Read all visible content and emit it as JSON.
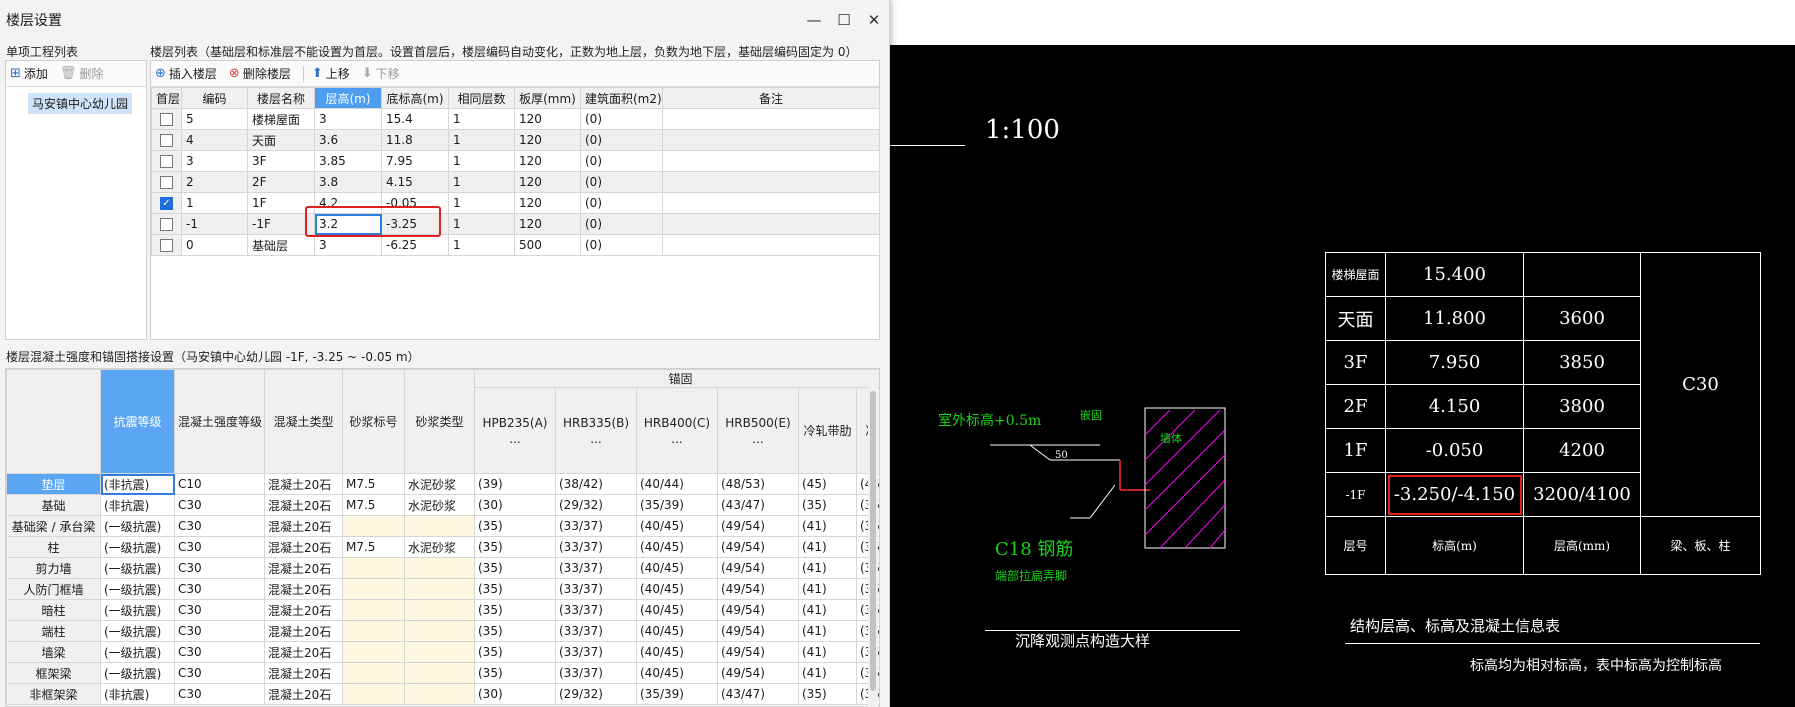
{
  "dialog": {
    "title": "楼层设置",
    "project_section_label": "单项工程列表",
    "floor_list_label": "楼层列表（基础层和标准层不能设置为首层。设置首层后，楼层编码自动变化，正数为地上层，负数为地下层，基础层编码固定为 0）",
    "project_toolbar": {
      "add": "添加",
      "delete": "删除"
    },
    "project_item": "马安镇中心幼儿园",
    "floor_toolbar": {
      "insert": "插入楼层",
      "delete": "删除楼层",
      "up": "上移",
      "down": "下移"
    },
    "floor_columns": [
      "首层",
      "编码",
      "楼层名称",
      "层高(m)",
      "底标高(m)",
      "相同层数",
      "板厚(mm)",
      "建筑面积(m2)",
      "备注"
    ],
    "floors": [
      {
        "code": "5",
        "name": "楼梯屋面",
        "height": "3",
        "bottom": "15.4",
        "same": "1",
        "slab": "120",
        "area": "(0)",
        "note": "",
        "first": false
      },
      {
        "code": "4",
        "name": "天面",
        "height": "3.6",
        "bottom": "11.8",
        "same": "1",
        "slab": "120",
        "area": "(0)",
        "note": "",
        "first": false
      },
      {
        "code": "3",
        "name": "3F",
        "height": "3.85",
        "bottom": "7.95",
        "same": "1",
        "slab": "120",
        "area": "(0)",
        "note": "",
        "first": false
      },
      {
        "code": "2",
        "name": "2F",
        "height": "3.8",
        "bottom": "4.15",
        "same": "1",
        "slab": "120",
        "area": "(0)",
        "note": "",
        "first": false
      },
      {
        "code": "1",
        "name": "1F",
        "height": "4.2",
        "bottom": "-0.05",
        "same": "1",
        "slab": "120",
        "area": "(0)",
        "note": "",
        "first": true
      },
      {
        "code": "-1",
        "name": "-1F",
        "height": "3.2",
        "bottom": "-3.25",
        "same": "1",
        "slab": "120",
        "area": "(0)",
        "note": "",
        "first": false
      },
      {
        "code": "0",
        "name": "基础层",
        "height": "3",
        "bottom": "-6.25",
        "same": "1",
        "slab": "500",
        "area": "(0)",
        "note": "",
        "first": false
      }
    ],
    "concrete_label": "楼层混凝土强度和锚固搭接设置（马安镇中心幼儿园  -1F, -3.25 ~ -0.05 m）",
    "conc_columns": [
      "抗震等级",
      "混凝土强度等级",
      "混凝土类型",
      "砂浆标号",
      "砂浆类型",
      "HPB235(A)",
      "HRB335(B)",
      "HRB400(C)",
      "HRB500(E)",
      "冷轧带肋",
      "冷"
    ],
    "anchor_group": "锚固",
    "ellipsis": "...",
    "conc_rows": [
      {
        "name": "垫层",
        "level": "(非抗震)",
        "grade": "C10",
        "type": "混凝土20石",
        "mortar": "M7.5",
        "mtype": "水泥砂浆",
        "a": "(39)",
        "b": "(38/42)",
        "c": "(40/44)",
        "e": "(48/53)",
        "f": "(45)",
        "g": "(45"
      },
      {
        "name": "基础",
        "level": "(非抗震)",
        "grade": "C30",
        "type": "混凝土20石",
        "mortar": "M7.5",
        "mtype": "水泥砂浆",
        "a": "(30)",
        "b": "(29/32)",
        "c": "(35/39)",
        "e": "(43/47)",
        "f": "(35)",
        "g": "(35"
      },
      {
        "name": "基础梁 / 承台梁",
        "level": "(一级抗震)",
        "grade": "C30",
        "type": "混凝土20石",
        "mortar": "",
        "mtype": "",
        "a": "(35)",
        "b": "(33/37)",
        "c": "(40/45)",
        "e": "(49/54)",
        "f": "(41)",
        "g": "(35"
      },
      {
        "name": "柱",
        "level": "(一级抗震)",
        "grade": "C30",
        "type": "混凝土20石",
        "mortar": "M7.5",
        "mtype": "水泥砂浆",
        "a": "(35)",
        "b": "(33/37)",
        "c": "(40/45)",
        "e": "(49/54)",
        "f": "(41)",
        "g": "(35"
      },
      {
        "name": "剪力墙",
        "level": "(一级抗震)",
        "grade": "C30",
        "type": "混凝土20石",
        "mortar": "",
        "mtype": "",
        "a": "(35)",
        "b": "(33/37)",
        "c": "(40/45)",
        "e": "(49/54)",
        "f": "(41)",
        "g": "(35"
      },
      {
        "name": "人防门框墙",
        "level": "(一级抗震)",
        "grade": "C30",
        "type": "混凝土20石",
        "mortar": "",
        "mtype": "",
        "a": "(35)",
        "b": "(33/37)",
        "c": "(40/45)",
        "e": "(49/54)",
        "f": "(41)",
        "g": "(35"
      },
      {
        "name": "暗柱",
        "level": "(一级抗震)",
        "grade": "C30",
        "type": "混凝土20石",
        "mortar": "",
        "mtype": "",
        "a": "(35)",
        "b": "(33/37)",
        "c": "(40/45)",
        "e": "(49/54)",
        "f": "(41)",
        "g": "(35"
      },
      {
        "name": "端柱",
        "level": "(一级抗震)",
        "grade": "C30",
        "type": "混凝土20石",
        "mortar": "",
        "mtype": "",
        "a": "(35)",
        "b": "(33/37)",
        "c": "(40/45)",
        "e": "(49/54)",
        "f": "(41)",
        "g": "(35"
      },
      {
        "name": "墙梁",
        "level": "(一级抗震)",
        "grade": "C30",
        "type": "混凝土20石",
        "mortar": "",
        "mtype": "",
        "a": "(35)",
        "b": "(33/37)",
        "c": "(40/45)",
        "e": "(49/54)",
        "f": "(41)",
        "g": "(35"
      },
      {
        "name": "框架梁",
        "level": "(一级抗震)",
        "grade": "C30",
        "type": "混凝土20石",
        "mortar": "",
        "mtype": "",
        "a": "(35)",
        "b": "(33/37)",
        "c": "(40/45)",
        "e": "(49/54)",
        "f": "(41)",
        "g": "(35"
      },
      {
        "name": "非框架梁",
        "level": "(非抗震)",
        "grade": "C30",
        "type": "混凝土20石",
        "mortar": "",
        "mtype": "",
        "a": "(30)",
        "b": "(29/32)",
        "c": "(35/39)",
        "e": "(43/47)",
        "f": "(35)",
        "g": "(35"
      }
    ]
  },
  "cad": {
    "scale": "1:100",
    "detail_title": "沉降观测点构造大样",
    "detail_label1": "室外标高+0.5m",
    "detail_label2": "C18 钢筋",
    "detail_label3": "端部拉扁弄脚",
    "detail_label4": "50",
    "detail_label5": "墙体",
    "detail_label6": "嵌固",
    "table_title": "结构层高、标高及混凝土信息表",
    "table_note": "标高均为相对标高，表中标高为控制标高",
    "rows": [
      {
        "floor": "楼梯屋面",
        "elev": "15.400",
        "height": ""
      },
      {
        "floor": "天面",
        "elev": "11.800",
        "height": "3600"
      },
      {
        "floor": "3F",
        "elev": "7.950",
        "height": "3850"
      },
      {
        "floor": "2F",
        "elev": "4.150",
        "height": "3800"
      },
      {
        "floor": "1F",
        "elev": "-0.050",
        "height": "4200"
      },
      {
        "floor": "-1F",
        "elev": "-3.250/-4.150",
        "height": "3200/4100"
      }
    ],
    "concrete": "C30",
    "headers": {
      "floor": "层号",
      "elev": "标高(m)",
      "height": "层高(mm)",
      "member": "梁、板、柱"
    }
  },
  "colors": {
    "accent": "#4d9ef0",
    "highlight_red": "#e02020",
    "cad_green": "#19d219",
    "cad_magenta": "#ff00ff"
  }
}
